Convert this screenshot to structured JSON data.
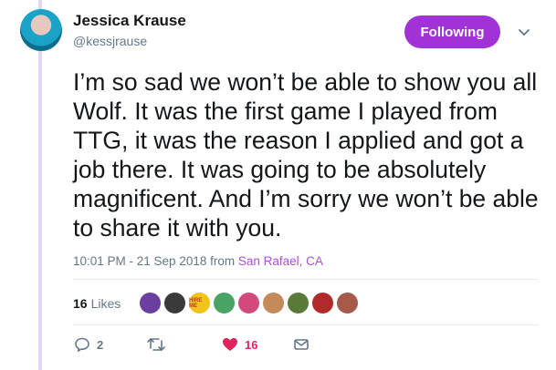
{
  "author": {
    "name": "Jessica Krause",
    "handle": "@kessjrause",
    "follow_label": "Following"
  },
  "tweet": {
    "text": "I’m so sad we won’t be able to show you all Wolf. It was the first game I played from TTG, it was the reason I applied and got a job there. It was going to be absolutely magnificent. And I’m sorry we won’t be able to share it with you.",
    "timestamp": "10:01 PM - 21 Sep 2018",
    "from_label": "from",
    "location": "San Rafael, CA"
  },
  "engagement": {
    "likes_count": "16",
    "likes_label": "Likes",
    "liker_avatar_colors": [
      "#6a3fa0",
      "#3a3a3a",
      "#f0c419",
      "#4aa564",
      "#d24a7a",
      "#c48a5a",
      "#5a7a3a",
      "#b02a2a",
      "#a85a4a"
    ],
    "liker_badge_text": "HIRE ME"
  },
  "actions": {
    "reply_count": "2",
    "retweet_count": "",
    "like_count": "16",
    "like_color": "#e0245e"
  },
  "theme": {
    "accent": "#a133d6",
    "link": "#b04de0",
    "muted": "#657786"
  }
}
